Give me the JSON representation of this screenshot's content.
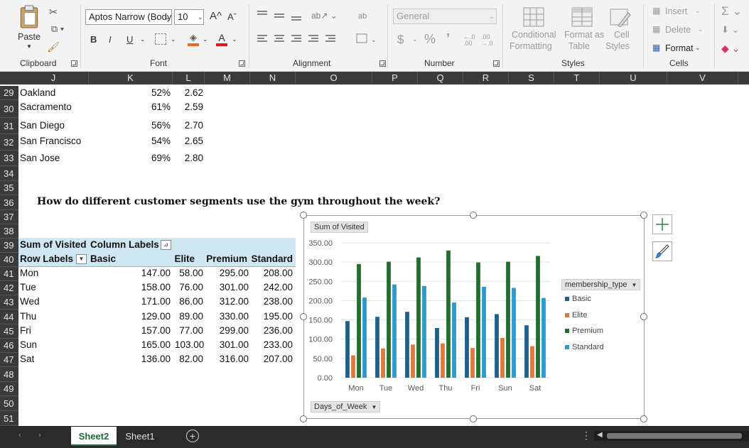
{
  "ribbon": {
    "clipboard": {
      "paste_label": "Paste",
      "group_label": "Clipboard"
    },
    "font": {
      "font_name": "Aptos Narrow (Body",
      "font_size": "10",
      "bold": "B",
      "italic": "I",
      "underline": "U",
      "group_label": "Font",
      "grow_label": "A",
      "shrink_label": "A",
      "font_color_label": "A"
    },
    "alignment": {
      "group_label": "Alignment"
    },
    "number": {
      "format_value": "General",
      "currency": "$",
      "percent": "%",
      "comma": "’",
      "inc_dec": "←.0 .00",
      "dec_dec": ".00 →.0",
      "group_label": "Number"
    },
    "styles": {
      "conditional_1": "Conditional",
      "conditional_2": "Formatting",
      "format_table_1": "Format as",
      "format_table_2": "Table",
      "cell_styles_1": "Cell",
      "cell_styles_2": "Styles",
      "group_label": "Styles"
    },
    "cells": {
      "insert": "Insert",
      "delete": "Delete",
      "format": "Format",
      "group_label": "Cells"
    }
  },
  "columns": [
    "J",
    "K",
    "L",
    "M",
    "N",
    "O",
    "P",
    "Q",
    "R",
    "S",
    "T",
    "U",
    "V"
  ],
  "rows": [
    "29",
    "30",
    "31",
    "32",
    "33",
    "34",
    "35",
    "36",
    "37",
    "38",
    "39",
    "40",
    "41",
    "42",
    "43",
    "44",
    "45",
    "46",
    "47",
    "48",
    "49",
    "50",
    "51"
  ],
  "city_table": [
    {
      "city": "Oakland",
      "pct": "52%",
      "val": "2.62"
    },
    {
      "city": "Sacramento",
      "pct": "61%",
      "val": "2.59"
    },
    {
      "city": "San Diego",
      "pct": "56%",
      "val": "2.70"
    },
    {
      "city": "San Francisco",
      "pct": "54%",
      "val": "2.65"
    },
    {
      "city": "San Jose",
      "pct": "69%",
      "val": "2.80"
    }
  ],
  "question": "How do different customer segments use the gym throughout the week?",
  "pivot": {
    "sum_label": "Sum of Visited",
    "col_labels": "Column Labels",
    "row_labels": "Row Labels",
    "headers": [
      "Basic",
      "Elite",
      "Premium",
      "Standard"
    ],
    "rows": [
      {
        "day": "Mon",
        "vals": [
          "147.00",
          "58.00",
          "295.00",
          "208.00"
        ]
      },
      {
        "day": "Tue",
        "vals": [
          "158.00",
          "76.00",
          "301.00",
          "242.00"
        ]
      },
      {
        "day": "Wed",
        "vals": [
          "171.00",
          "86.00",
          "312.00",
          "238.00"
        ]
      },
      {
        "day": "Thu",
        "vals": [
          "129.00",
          "89.00",
          "330.00",
          "195.00"
        ]
      },
      {
        "day": "Fri",
        "vals": [
          "157.00",
          "77.00",
          "299.00",
          "236.00"
        ]
      },
      {
        "day": "Sun",
        "vals": [
          "165.00",
          "103.00",
          "301.00",
          "233.00"
        ]
      },
      {
        "day": "Sat",
        "vals": [
          "136.00",
          "82.00",
          "316.00",
          "207.00"
        ]
      }
    ]
  },
  "chart_data": {
    "type": "bar",
    "title": "Sum of Visited",
    "categories": [
      "Mon",
      "Tue",
      "Wed",
      "Thu",
      "Fri",
      "Sun",
      "Sat"
    ],
    "series": [
      {
        "name": "Basic",
        "color": "#1f5f8b",
        "values": [
          147,
          158,
          171,
          129,
          157,
          165,
          136
        ]
      },
      {
        "name": "Elite",
        "color": "#e2773c",
        "values": [
          58,
          76,
          86,
          89,
          77,
          103,
          82
        ]
      },
      {
        "name": "Premium",
        "color": "#236e2f",
        "values": [
          295,
          301,
          312,
          330,
          299,
          301,
          316
        ]
      },
      {
        "name": "Standard",
        "color": "#2a9ad0",
        "values": [
          208,
          242,
          238,
          195,
          236,
          233,
          207
        ]
      }
    ],
    "ylim": [
      0,
      350
    ],
    "yticks": [
      "0.00",
      "50.00",
      "100.00",
      "150.00",
      "200.00",
      "250.00",
      "300.00",
      "350.00"
    ],
    "legend_title": "membership_type",
    "legend_position": "right",
    "axis_field_button": "Days_of_Week",
    "grid": true
  },
  "sheets": {
    "active": "Sheet2",
    "other": "Sheet1"
  }
}
